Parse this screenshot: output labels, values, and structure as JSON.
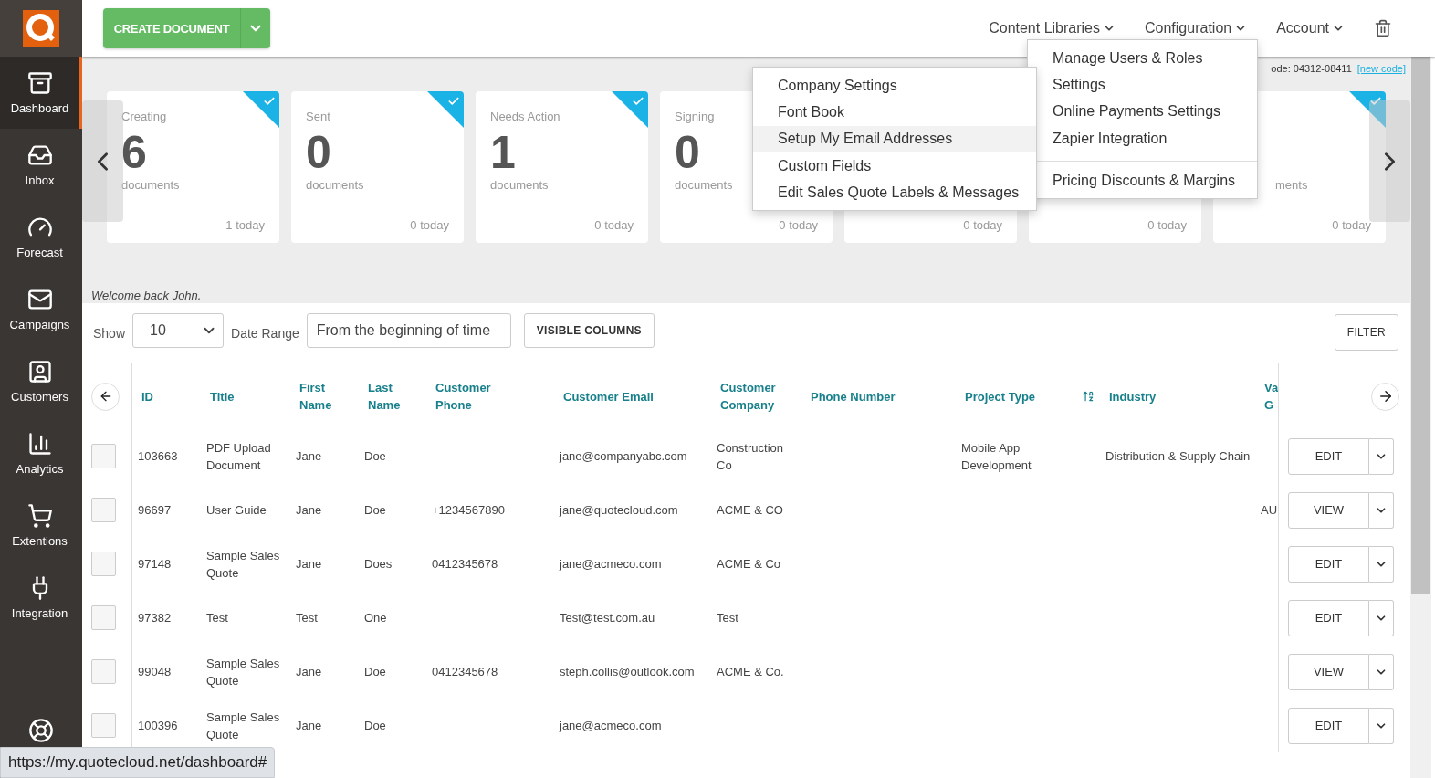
{
  "sidebar": {
    "items": [
      {
        "label": "Dashboard",
        "selected": true
      },
      {
        "label": "Inbox",
        "selected": false
      },
      {
        "label": "Forecast",
        "selected": false
      },
      {
        "label": "Campaigns",
        "selected": false
      },
      {
        "label": "Customers",
        "selected": false
      },
      {
        "label": "Analytics",
        "selected": false
      },
      {
        "label": "Extentions",
        "selected": false
      },
      {
        "label": "Integration",
        "selected": false
      }
    ]
  },
  "toolbar": {
    "create_button": "CREATE DOCUMENT"
  },
  "nav": [
    {
      "label": "Content Libraries"
    },
    {
      "label": "Configuration"
    },
    {
      "label": "Account"
    }
  ],
  "configuration_menu": {
    "groups": [
      [
        "Manage Users & Roles",
        "Settings",
        "Online Payments Settings",
        "Zapier Integration"
      ],
      [
        "Pricing Discounts & Margins"
      ]
    ]
  },
  "submenu": {
    "items": [
      {
        "label": "Company Settings",
        "selected": false
      },
      {
        "label": "Font Book",
        "selected": false
      },
      {
        "label": "Setup My Email Addresses",
        "selected": true
      },
      {
        "label": "Custom Fields",
        "selected": false
      },
      {
        "label": "Edit Sales Quote Labels & Messages",
        "selected": false
      }
    ]
  },
  "code_line": {
    "text": "ode: 04312-08411",
    "link": "[new code]"
  },
  "cards": [
    {
      "title": "Creating",
      "count": "6",
      "count_label": "documents",
      "today": "1 today",
      "checked": true
    },
    {
      "title": "Sent",
      "count": "0",
      "count_label": "documents",
      "today": "0 today",
      "checked": true
    },
    {
      "title": "Needs Action",
      "count": "1",
      "count_label": "documents",
      "today": "0 today",
      "checked": true
    },
    {
      "title": "Signing",
      "count": "0",
      "count_label": "documents",
      "today": "0 today"
    },
    {
      "today": "0 today"
    },
    {
      "today": "0 today"
    },
    {
      "kind": "partial",
      "count_label": "ments",
      "today": "0 today",
      "checked": true
    }
  ],
  "welcome": "Welcome back John.",
  "filters": {
    "show_label": "Show",
    "page_size": "10",
    "date_label": "Date Range",
    "date_value": "From the beginning of time",
    "visible_columns": "VISIBLE COLUMNS",
    "filter": "FILTER"
  },
  "table": {
    "columns": [
      "ID",
      "Title",
      "First Name",
      "Last Name",
      "Customer Phone",
      "Customer Email",
      "Customer Company",
      "Phone Number",
      "Project Type",
      "Industry",
      "Va G"
    ],
    "rows": [
      {
        "checked": false,
        "id": "103663",
        "title": "PDF Upload Document",
        "first_name": "Jane",
        "last_name": "Doe",
        "customer_email": "jane@companyabc.com",
        "customer_company": "Construction Co",
        "project_type": "Mobile App Development",
        "industry": "Distribution & Supply Chain",
        "action": "EDIT"
      },
      {
        "checked": false,
        "id": "96697",
        "title": "User Guide",
        "first_name": "Jane",
        "last_name": "Doe",
        "customer_phone": "+1234567890",
        "customer_email": "jane@quotecloud.com",
        "customer_company": "ACME & CO",
        "column_11": "AU",
        "action": "VIEW"
      },
      {
        "checked": false,
        "id": "97148",
        "title": "Sample Sales Quote",
        "first_name": "Jane",
        "last_name": "Does",
        "customer_phone": "0412345678",
        "customer_email": "jane@acmeco.com",
        "customer_company": "ACME & Co",
        "action": "EDIT"
      },
      {
        "checked": false,
        "id": "97382",
        "title": "Test",
        "first_name": "Test",
        "last_name": "One",
        "customer_email": "Test@test.com.au",
        "customer_company": "Test",
        "action": "EDIT"
      },
      {
        "checked": false,
        "id": "99048",
        "title": "Sample Sales Quote",
        "first_name": "Jane",
        "last_name": "Doe",
        "customer_phone": "0412345678",
        "customer_email": "steph.collis@outlook.com",
        "customer_company": "ACME & Co.",
        "action": "VIEW"
      },
      {
        "checked": false,
        "id": "100396",
        "title": "Sample Sales Quote",
        "first_name": "Jane",
        "last_name": "Doe",
        "customer_email": "jane@acmeco.com",
        "action": "EDIT"
      }
    ]
  },
  "status_url": "https://my.quotecloud.net/dashboard#"
}
